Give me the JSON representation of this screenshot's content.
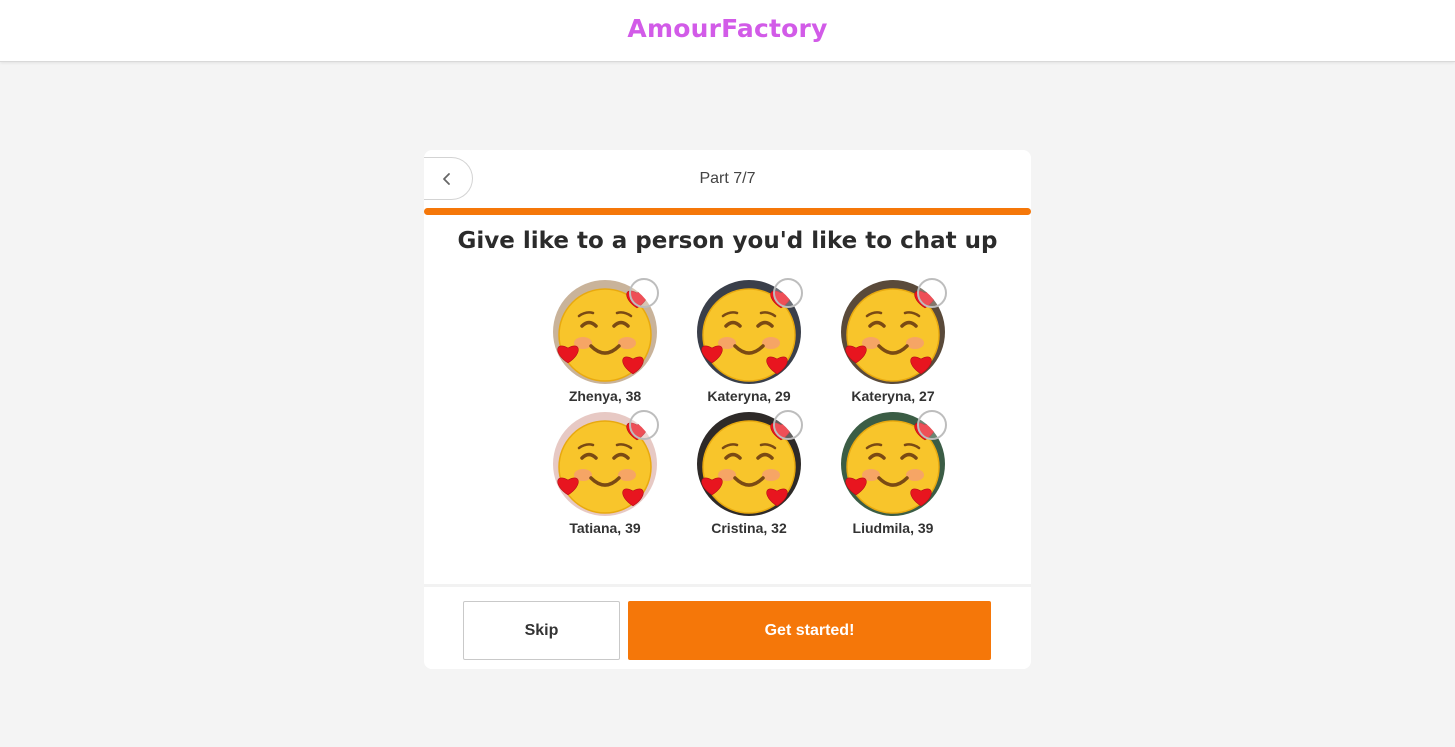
{
  "app": {
    "logo_text": "AmourFactory",
    "brand_color": "#d25be8"
  },
  "quiz": {
    "part_label": "Part 7/7",
    "progress": 1.0,
    "accent_color": "#f57709",
    "title": "Give like to a person you'd like to chat up",
    "back_icon": "chevron-left-icon"
  },
  "people": [
    {
      "name": "Zhenya, 38",
      "photo": "avatar-photo-1",
      "liked": false
    },
    {
      "name": "Kateryna, 29",
      "photo": "avatar-photo-2",
      "liked": false
    },
    {
      "name": "Kateryna, 27",
      "photo": "avatar-photo-3",
      "liked": false
    },
    {
      "name": "Tatiana, 39",
      "photo": "avatar-photo-4",
      "liked": false
    },
    {
      "name": "Cristina, 32",
      "photo": "avatar-photo-5",
      "liked": false
    },
    {
      "name": "Liudmila, 39",
      "photo": "avatar-photo-6",
      "liked": false
    }
  ],
  "actions": {
    "skip_label": "Skip",
    "start_label": "Get started!"
  }
}
